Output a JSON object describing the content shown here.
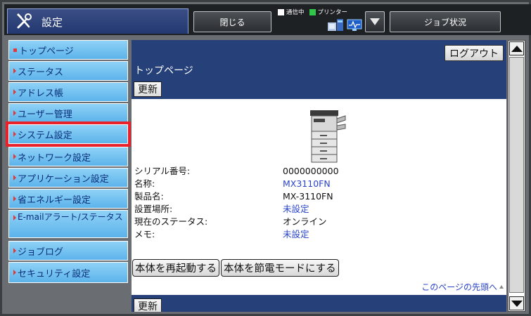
{
  "topbar": {
    "title": "設定",
    "close_label": "閉じる",
    "status_comm": "通信中",
    "status_printer": "プリンター",
    "job_label": "ジョブ状況"
  },
  "sidebar": {
    "items": [
      {
        "label": "トップページ"
      },
      {
        "label": "ステータス"
      },
      {
        "label": "アドレス帳"
      },
      {
        "label": "ユーザー管理"
      },
      {
        "label": "システム設定"
      },
      {
        "label": "ネットワーク設定"
      },
      {
        "label": "アプリケーション設定"
      },
      {
        "label": "省エネルギー設定"
      },
      {
        "label": "E-mailアラート/ステータス"
      },
      {
        "label": "ジョブログ"
      },
      {
        "label": "セキュリティ設定"
      }
    ]
  },
  "main": {
    "logout_label": "ログアウト",
    "page_title": "トップページ",
    "update_label": "更新",
    "info": [
      {
        "label": "シリアル番号:",
        "value": "0000000000"
      },
      {
        "label": "名称:",
        "value": "MX3110FN"
      },
      {
        "label": "製品名:",
        "value": "MX-3110FN"
      },
      {
        "label": "設置場所:",
        "value": "未設定"
      },
      {
        "label": "現在のステータス:",
        "value": "オンライン"
      },
      {
        "label": "メモ:",
        "value": "未設定"
      }
    ],
    "restart_label": "本体を再起動する",
    "power_save_label": "本体を節電モードにする",
    "page_top_link": "このページの先頭へ"
  },
  "colors": {
    "nav_bg": "#6fc0f0",
    "header_band": "#26407a",
    "selected_outline": "#e8212b",
    "link": "#2a44c8"
  }
}
